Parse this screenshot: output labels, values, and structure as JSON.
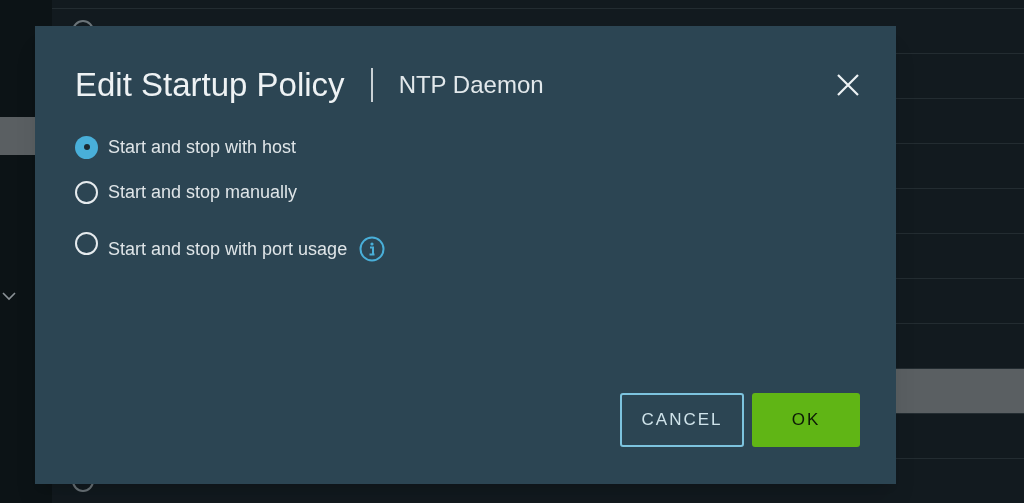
{
  "services": [
    {
      "selected": false
    },
    {
      "selected": false
    },
    {
      "selected": false
    },
    {
      "selected": false
    },
    {
      "selected": false
    },
    {
      "selected": false
    },
    {
      "selected": false
    },
    {
      "selected": false
    },
    {
      "selected": true
    },
    {
      "selected": false
    },
    {
      "selected": false
    }
  ],
  "dialog": {
    "title": "Edit Startup Policy",
    "subtitle": "NTP Daemon",
    "options": [
      {
        "label": "Start and stop with host",
        "selected": true,
        "info": false
      },
      {
        "label": "Start and stop manually",
        "selected": false,
        "info": false
      },
      {
        "label": "Start and stop with port usage",
        "selected": false,
        "info": true
      }
    ],
    "buttons": [
      {
        "label": "CANCEL",
        "kind": "secondary"
      },
      {
        "label": "OK",
        "kind": "primary"
      }
    ]
  }
}
